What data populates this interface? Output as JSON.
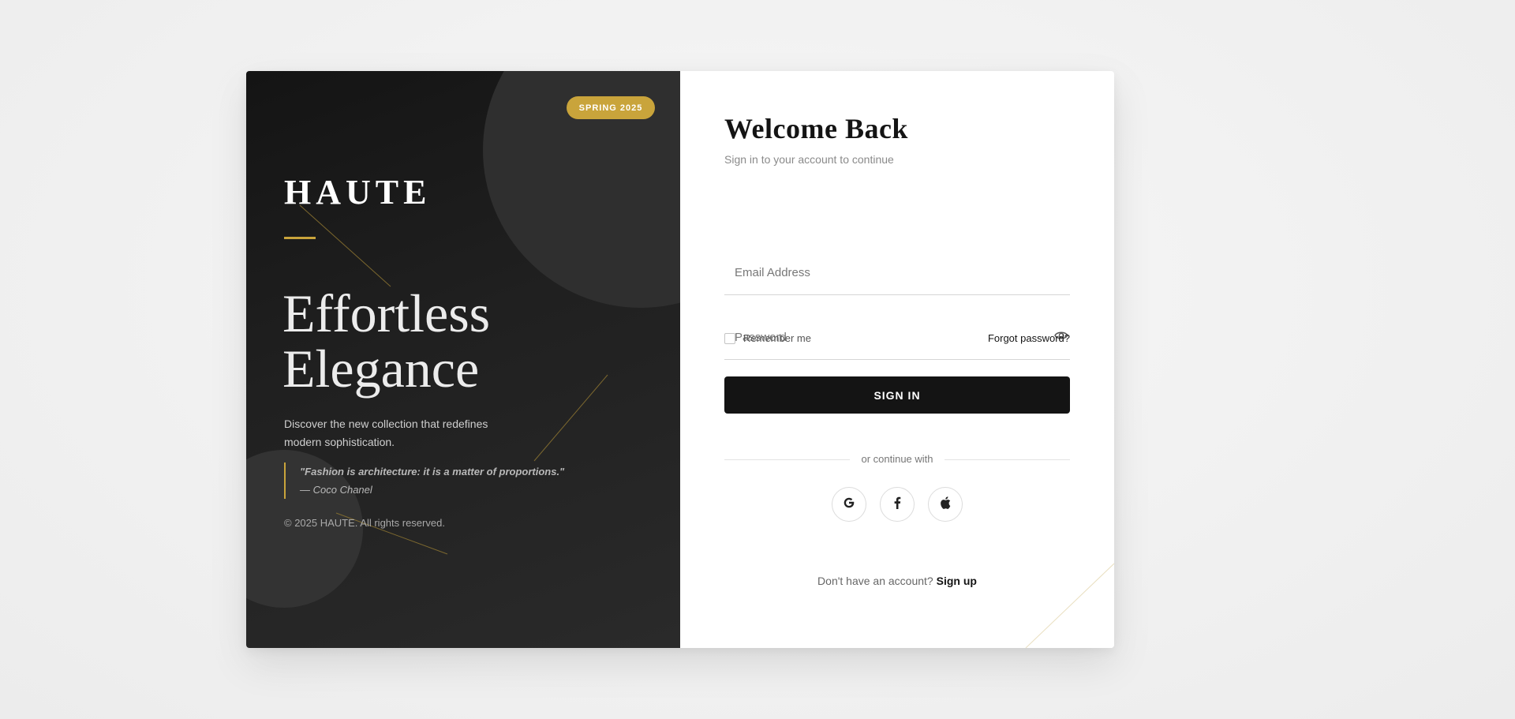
{
  "brand": {
    "logo": "HAUTE",
    "season_badge": "SPRING 2025",
    "accent_color": "#c9a43b",
    "dark_color": "#141414"
  },
  "hero": {
    "headline_line1": "Effortless",
    "headline_line2": "Elegance",
    "tagline_line1": "Discover the new collection that redefines",
    "tagline_line2": "modern sophistication.",
    "quote": "\"Fashion is architecture: it is a matter of proportions.\"",
    "quote_author": "— Coco Chanel",
    "copyright": "© 2025 HAUTE. All rights reserved."
  },
  "login": {
    "title": "Welcome Back",
    "subtitle": "Sign in to your account to continue",
    "email_placeholder": "Email Address",
    "email_value": "",
    "password_placeholder": "Password",
    "password_value": "",
    "remember_label": "Remember me",
    "remember_checked": false,
    "forgot_label": "Forgot password?",
    "signin_label": "SIGN IN",
    "divider_text": "or continue with",
    "social": [
      {
        "name": "google",
        "icon": "google-icon",
        "glyph": "G"
      },
      {
        "name": "facebook",
        "icon": "facebook-icon",
        "glyph": "f"
      },
      {
        "name": "apple",
        "icon": "apple-icon",
        "glyph": ""
      }
    ],
    "signup_prompt": "Don't have an account?",
    "signup_label": "Sign up"
  }
}
